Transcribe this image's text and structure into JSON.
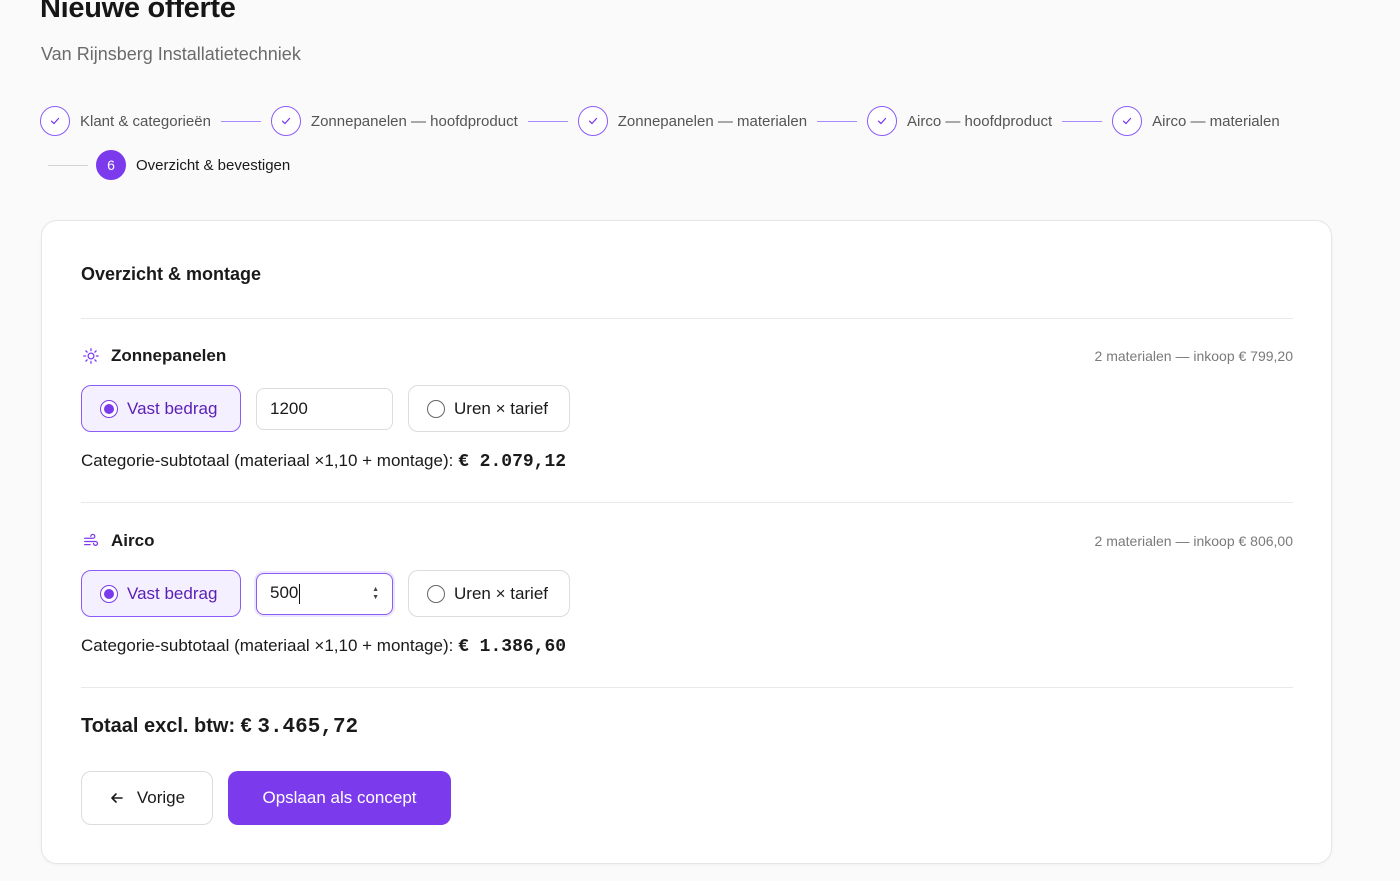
{
  "header": {
    "title": "Nieuwe offerte",
    "subtitle": "Van Rijnsberg Installatietechniek"
  },
  "stepper": {
    "steps": [
      {
        "label": "Klant & categorieën",
        "state": "done"
      },
      {
        "label": "Zonnepanelen — hoofdproduct",
        "state": "done"
      },
      {
        "label": "Zonnepanelen — materialen",
        "state": "done"
      },
      {
        "label": "Airco — hoofdproduct",
        "state": "done"
      },
      {
        "label": "Airco — materialen",
        "state": "done"
      },
      {
        "label": "Overzicht & bevestigen",
        "state": "active",
        "number": "6"
      }
    ]
  },
  "card": {
    "title": "Overzicht & montage",
    "sections": [
      {
        "name": "Zonnepanelen",
        "icon": "sun-icon",
        "meta": "2 materialen — inkoop € 799,20",
        "option_fixed": "Vast bedrag",
        "option_hours": "Uren × tarief",
        "selected": "fixed",
        "amount": "1200",
        "subtotal_label": "Categorie-subtotaal (materiaal ×1,10 + montage):",
        "subtotal_value": "€ 2.079,12"
      },
      {
        "name": "Airco",
        "icon": "wind-icon",
        "meta": "2 materialen — inkoop € 806,00",
        "option_fixed": "Vast bedrag",
        "option_hours": "Uren × tarief",
        "selected": "fixed",
        "amount": "500",
        "subtotal_label": "Categorie-subtotaal (materiaal ×1,10 + montage):",
        "subtotal_value": "€ 1.386,60"
      }
    ],
    "total_label": "Totaal excl. btw: €",
    "total_value": "3.465,72",
    "btn_prev": "Vorige",
    "btn_save": "Opslaan als concept"
  },
  "colors": {
    "accent": "#7c3aed",
    "accent_light": "#f4f0ff",
    "border": "#dcdcdc"
  }
}
